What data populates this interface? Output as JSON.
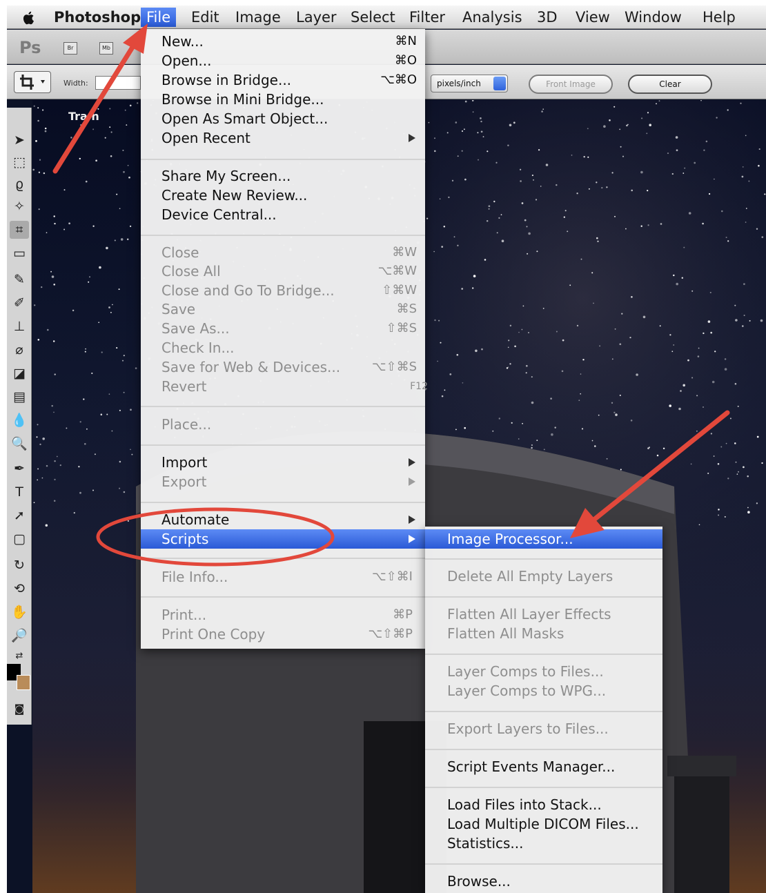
{
  "menubar": {
    "apple_icon": "apple-icon",
    "app_name": "Photoshop",
    "items": [
      "File",
      "Edit",
      "Image",
      "Layer",
      "Select",
      "Filter",
      "Analysis",
      "3D",
      "View",
      "Window",
      "Help"
    ]
  },
  "appbar": {
    "logo": "Ps",
    "bridge_label": "Br",
    "minibridge_label": "Mb"
  },
  "options": {
    "width_label": "Width:",
    "resolution_unit": "pixels/inch",
    "front_image_label": "Front Image",
    "clear_label": "Clear"
  },
  "document": {
    "tab_label": "Tra  n"
  },
  "file_menu": {
    "items": [
      {
        "label": "New...",
        "shortcut": "⌘N"
      },
      {
        "label": "Open...",
        "shortcut": "⌘O"
      },
      {
        "label": "Browse in Bridge...",
        "shortcut": "⌥⌘O"
      },
      {
        "label": "Browse in Mini Bridge...",
        "shortcut": ""
      },
      {
        "label": "Open As Smart Object...",
        "shortcut": ""
      },
      {
        "label": "Open Recent",
        "shortcut": ""
      },
      {
        "label": "Share My Screen...",
        "shortcut": ""
      },
      {
        "label": "Create New Review...",
        "shortcut": ""
      },
      {
        "label": "Device Central...",
        "shortcut": ""
      },
      {
        "label": "Close",
        "shortcut": "⌘W"
      },
      {
        "label": "Close All",
        "shortcut": "⌥⌘W"
      },
      {
        "label": "Close and Go To Bridge...",
        "shortcut": "⇧⌘W"
      },
      {
        "label": "Save",
        "shortcut": "⌘S"
      },
      {
        "label": "Save As...",
        "shortcut": "⇧⌘S"
      },
      {
        "label": "Check In...",
        "shortcut": ""
      },
      {
        "label": "Save for Web & Devices...",
        "shortcut": "⌥⇧⌘S"
      },
      {
        "label": "Revert",
        "shortcut": "F12"
      },
      {
        "label": "Place...",
        "shortcut": ""
      },
      {
        "label": "Import",
        "shortcut": ""
      },
      {
        "label": "Export",
        "shortcut": ""
      },
      {
        "label": "Automate",
        "shortcut": ""
      },
      {
        "label": "Scripts",
        "shortcut": ""
      },
      {
        "label": "File Info...",
        "shortcut": "⌥⇧⌘I"
      },
      {
        "label": "Print...",
        "shortcut": "⌘P"
      },
      {
        "label": "Print One Copy",
        "shortcut": "⌥⇧⌘P"
      }
    ]
  },
  "scripts_menu": {
    "items": [
      "Image Processor...",
      "Delete All Empty Layers",
      "Flatten All Layer Effects",
      "Flatten All Masks",
      "Layer Comps to Files...",
      "Layer Comps to WPG...",
      "Export Layers to Files...",
      "Script Events Manager...",
      "Load Files into Stack...",
      "Load Multiple DICOM Files...",
      "Statistics...",
      "Browse..."
    ]
  },
  "colors": {
    "highlight": "#2f63dd",
    "annotation_red": "#e2483b",
    "menu_bg": "#f2f2f2",
    "sky": "#0b1330"
  }
}
